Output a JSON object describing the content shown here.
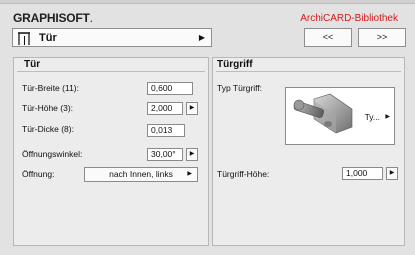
{
  "header": {
    "logo_bold": "GRAPHISOFT",
    "logo_dot": ".",
    "library_title": "ArchiCARD-Bibliothek"
  },
  "selector": {
    "label": "Tür",
    "icon": "door-icon"
  },
  "nav": {
    "prev_label": "<<",
    "next_label": ">>"
  },
  "left_panel": {
    "title": "Tür",
    "rows": {
      "width": {
        "label": "Tür-Breite (11):",
        "value": "0,600"
      },
      "height": {
        "label": "Tür-Höhe (3):",
        "value": "2,000"
      },
      "depth": {
        "label": "Tür-Dicke (8):",
        "value": "0,013"
      },
      "angle": {
        "label": "Öffnungswinkel:",
        "value": "30,00°"
      },
      "opening": {
        "label": "Öffnung:",
        "value": "nach Innen, links"
      }
    }
  },
  "right_panel": {
    "title": "Türgriff",
    "handle_type": {
      "label": "Typ Türgriff:",
      "value": "Ty..."
    },
    "handle_height": {
      "label": "Türgriff-Höhe:",
      "value": "1,000"
    }
  },
  "colors": {
    "accent_red": "#d61a1a",
    "background": "#e2e2e2"
  }
}
